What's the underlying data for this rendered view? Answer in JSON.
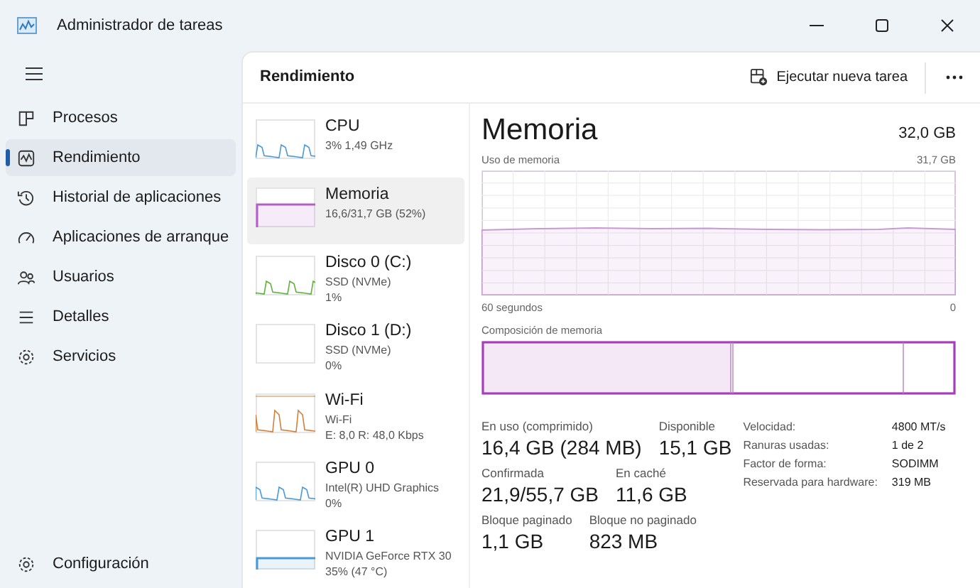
{
  "window": {
    "title": "Administrador de tareas"
  },
  "sidebar": {
    "items": [
      {
        "label": "Procesos",
        "selected": false
      },
      {
        "label": "Rendimiento",
        "selected": true
      },
      {
        "label": "Historial de aplicaciones",
        "selected": false
      },
      {
        "label": "Aplicaciones de arranque",
        "selected": false
      },
      {
        "label": "Usuarios",
        "selected": false
      },
      {
        "label": "Detalles",
        "selected": false
      },
      {
        "label": "Servicios",
        "selected": false
      }
    ],
    "footer": {
      "label": "Configuración"
    }
  },
  "header": {
    "title": "Rendimiento",
    "run_task_button": "Ejecutar nueva tarea"
  },
  "devices": [
    {
      "name": "CPU",
      "lines": [
        "3%  1,49 GHz"
      ],
      "color": "#4a9ad8",
      "kind": "spiky",
      "selected": false
    },
    {
      "name": "Memoria",
      "lines": [
        "16,6/31,7 GB (52%)"
      ],
      "color": "#b45ec8",
      "kind": "filled",
      "selected": true
    },
    {
      "name": "Disco 0 (C:)",
      "lines": [
        "SSD (NVMe)",
        "1%"
      ],
      "color": "#5fb33c",
      "kind": "spiky",
      "selected": false
    },
    {
      "name": "Disco 1 (D:)",
      "lines": [
        "SSD (NVMe)",
        "0%"
      ],
      "kind": "empty",
      "selected": false
    },
    {
      "name": "Wi-Fi",
      "lines": [
        "Wi-Fi",
        "E: 8,0 R: 48,0 Kbps"
      ],
      "color": "#d3803b",
      "kind": "spiky",
      "selected": false
    },
    {
      "name": "GPU 0",
      "lines": [
        "Intel(R) UHD Graphics",
        "0%"
      ],
      "color": "#4a9ad8",
      "kind": "spiky",
      "selected": false
    },
    {
      "name": "GPU 1",
      "lines": [
        "NVIDIA GeForce RTX 30",
        "35% (47 °C)"
      ],
      "color": "#4a9ad8",
      "kind": "filled",
      "selected": false
    }
  ],
  "detail": {
    "title": "Memoria",
    "total": "32,0 GB",
    "graph_label": "Uso de memoria",
    "graph_max": "31,7 GB",
    "graph_start": "60 segundos",
    "graph_end": "0",
    "composition_label": "Composición de memoria",
    "stats": [
      [
        {
          "label": "En uso (comprimido)",
          "value": "16,4 GB (284 MB)"
        },
        {
          "label": "Disponible",
          "value": "15,1 GB"
        }
      ],
      [
        {
          "label": "Confirmada",
          "value": "21,9/55,7 GB"
        },
        {
          "label": "En caché",
          "value": "11,6 GB"
        }
      ],
      [
        {
          "label": "Bloque paginado",
          "value": "1,1 GB"
        },
        {
          "label": "Bloque no paginado",
          "value": "823 MB"
        }
      ]
    ],
    "properties": [
      {
        "label": "Velocidad:",
        "value": "4800 MT/s"
      },
      {
        "label": "Ranuras usadas:",
        "value": "1 de 2"
      },
      {
        "label": "Factor de forma:",
        "value": "SODIMM"
      },
      {
        "label": "Reservada para hardware:",
        "value": "319 MB"
      }
    ]
  }
}
